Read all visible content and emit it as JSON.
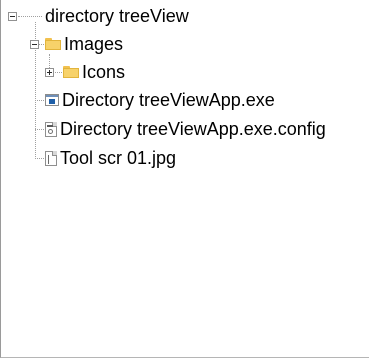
{
  "tree": {
    "root": {
      "label": "directory treeView",
      "expander": "minus"
    },
    "items": [
      {
        "label": "Images",
        "icon": "folder-icon",
        "expander": "minus"
      },
      {
        "label": "Icons",
        "icon": "folder-icon",
        "expander": "plus"
      },
      {
        "label": "Directory treeViewApp.exe",
        "icon": "exe-file-icon"
      },
      {
        "label": "Directory treeViewApp.exe.config",
        "icon": "config-file-icon"
      },
      {
        "label": "Tool scr 01.jpg",
        "icon": "image-file-icon"
      }
    ]
  },
  "colors": {
    "folder": "#f7d26a",
    "exe_accent": "#1f5fa8",
    "lines": "#a0a0a0"
  }
}
